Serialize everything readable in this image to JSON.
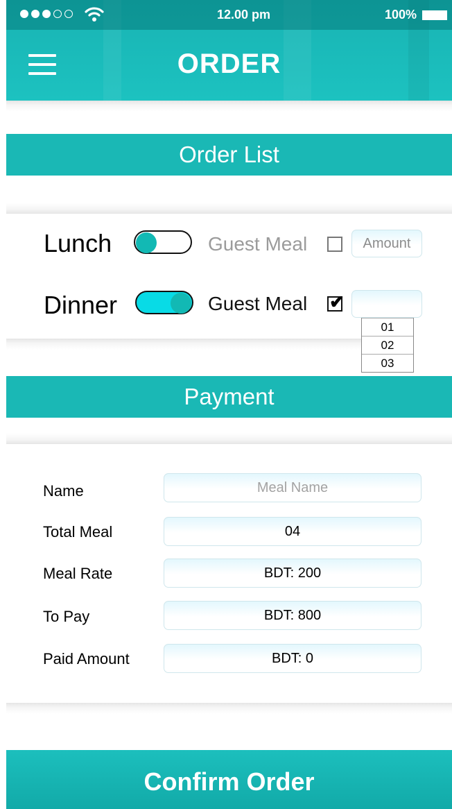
{
  "status_bar": {
    "signal_filled": 3,
    "signal_total": 5,
    "time": "12.00 pm",
    "battery": "100%"
  },
  "header": {
    "title": "ORDER",
    "menu_icon": "hamburger-menu-icon"
  },
  "order_list": {
    "heading": "Order List",
    "rows": [
      {
        "meal": "Lunch",
        "toggle_on": false,
        "guest_label": "Guest Meal",
        "guest_checked": false,
        "amount_placeholder": "Amount",
        "amount_value": ""
      },
      {
        "meal": "Dinner",
        "toggle_on": true,
        "guest_label": "Guest Meal",
        "guest_checked": true,
        "amount_placeholder": "",
        "amount_value": ""
      }
    ],
    "guest_amount_options": [
      "01",
      "02",
      "03"
    ]
  },
  "payment": {
    "heading": "Payment",
    "fields": {
      "name": {
        "label": "Name",
        "placeholder": "Meal Name",
        "value": ""
      },
      "total_meal": {
        "label": "Total Meal",
        "value": "04"
      },
      "meal_rate": {
        "label": "Meal Rate",
        "value": "BDT: 200"
      },
      "to_pay": {
        "label": "To Pay",
        "value": "BDT: 800"
      },
      "paid_amount": {
        "label": "Paid Amount",
        "value": "BDT: 0"
      }
    }
  },
  "confirm_label": "Confirm Order",
  "colors": {
    "teal": "#1ab8b5",
    "toggle_on": "#08dbe6",
    "knob": "#12b9b4"
  }
}
